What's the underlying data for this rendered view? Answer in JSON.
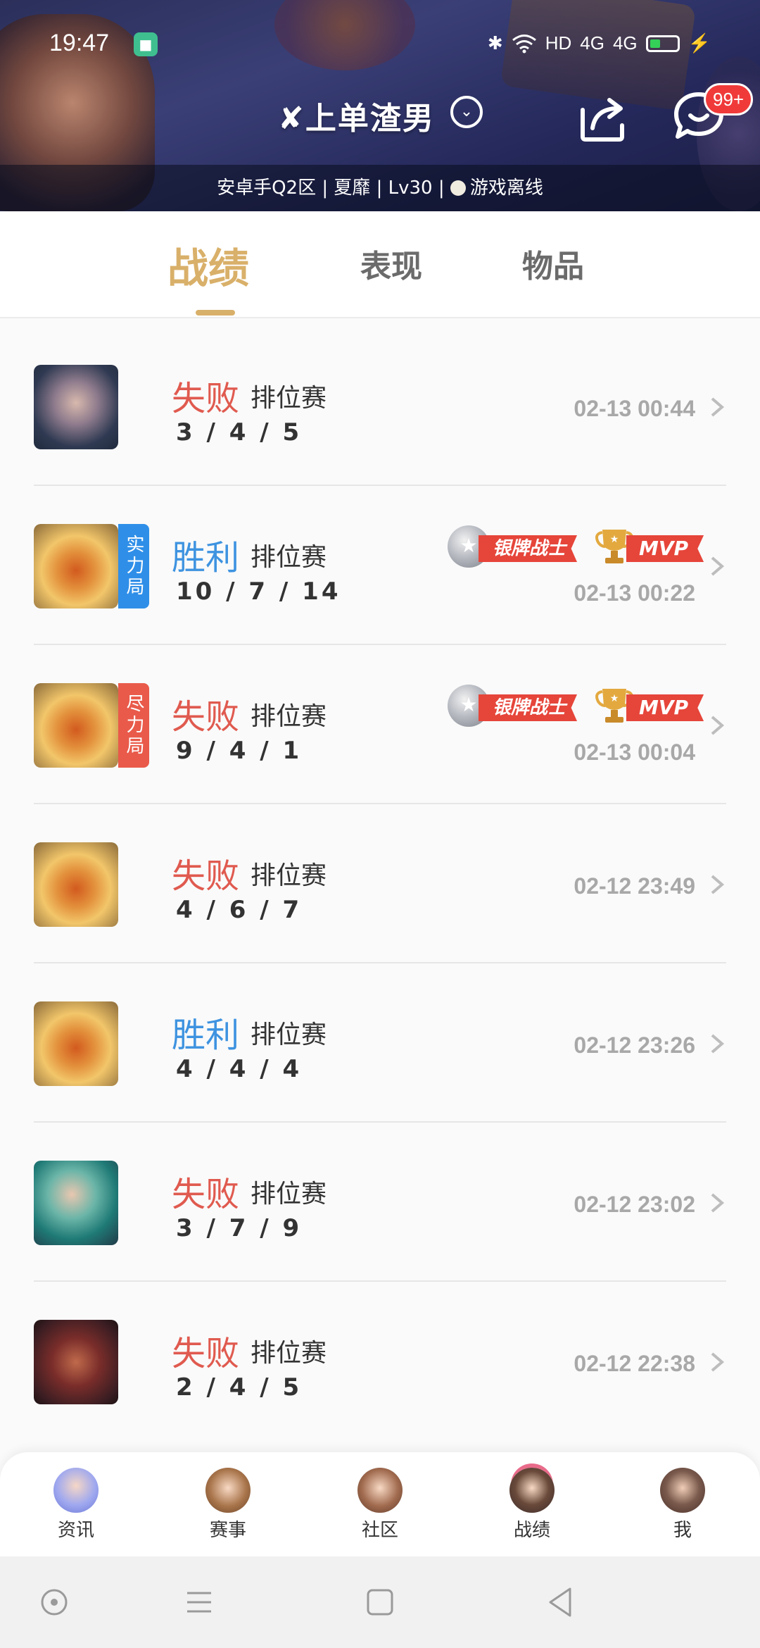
{
  "status_bar": {
    "time": "19:47",
    "network": "HD",
    "signal1": "4G",
    "signal2": "4G"
  },
  "header": {
    "player_name": "✘上单渣男",
    "notification_badge": "99+",
    "info_line": "安卓手Q2区 | 夏靡 | Lv30 |",
    "online_status": "游戏离线"
  },
  "tabs": [
    {
      "label": "战绩",
      "active": true
    },
    {
      "label": "表现",
      "active": false
    },
    {
      "label": "物品",
      "active": false
    }
  ],
  "matches": [
    {
      "result": "失败",
      "outcome": "lose",
      "mode": "排位赛",
      "kda": "3 / 4 / 5",
      "time": "02-13 00:44",
      "avatar": "girl",
      "tag": "",
      "honors": false
    },
    {
      "result": "胜利",
      "outcome": "win",
      "mode": "排位赛",
      "kda": "10 / 7 / 14",
      "time": "02-13 00:22",
      "avatar": "gold",
      "tag": "实力局",
      "tag_color": "blue",
      "honors": true
    },
    {
      "result": "失败",
      "outcome": "lose",
      "mode": "排位赛",
      "kda": "9 / 4 / 1",
      "time": "02-13 00:04",
      "avatar": "gold",
      "tag": "尽力局",
      "tag_color": "red",
      "honors": true
    },
    {
      "result": "失败",
      "outcome": "lose",
      "mode": "排位赛",
      "kda": "4 / 6 / 7",
      "time": "02-12 23:49",
      "avatar": "gold",
      "tag": "",
      "honors": false
    },
    {
      "result": "胜利",
      "outcome": "win",
      "mode": "排位赛",
      "kda": "4 / 4 / 4",
      "time": "02-12 23:26",
      "avatar": "gold",
      "tag": "",
      "honors": false
    },
    {
      "result": "失败",
      "outcome": "lose",
      "mode": "排位赛",
      "kda": "3 / 7 / 9",
      "time": "02-12 23:02",
      "avatar": "green",
      "tag": "",
      "honors": false
    },
    {
      "result": "失败",
      "outcome": "lose",
      "mode": "排位赛",
      "kda": "2 / 4 / 5",
      "time": "02-12 22:38",
      "avatar": "red",
      "tag": "",
      "honors": false
    }
  ],
  "honors": {
    "silver_label": "银牌战士",
    "mvp_label": "MVP"
  },
  "bottom_nav": [
    {
      "label": "资讯"
    },
    {
      "label": "赛事"
    },
    {
      "label": "社区"
    },
    {
      "label": "战绩"
    },
    {
      "label": "我"
    }
  ],
  "colors": {
    "accent_gold": "#d9b06a",
    "lose_red": "#e05a4f",
    "win_blue": "#3e93e0",
    "badge_red": "#f03a3a"
  },
  "icons": {
    "share": "share-icon",
    "chat": "chat-icon",
    "dropdown": "chevron-down-circle-icon",
    "row_arrow": "chevron-right-icon",
    "bluetooth": "bluetooth-icon",
    "wifi": "wifi-icon"
  }
}
